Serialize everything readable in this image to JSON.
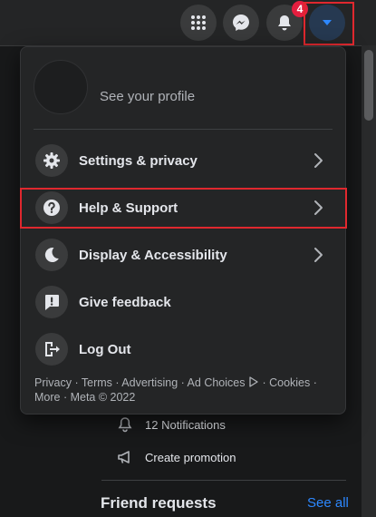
{
  "topbar": {
    "notifications_badge": "4",
    "icons": [
      "menu-grid-icon",
      "messenger-icon",
      "bell-icon",
      "caret-down-icon"
    ]
  },
  "account_menu": {
    "profile_link": "See your profile",
    "items": [
      {
        "label": "Settings & privacy",
        "icon": "gear-icon",
        "has_chevron": true
      },
      {
        "label": "Help & Support",
        "icon": "question-icon",
        "has_chevron": true
      },
      {
        "label": "Display & Accessibility",
        "icon": "moon-icon",
        "has_chevron": true
      },
      {
        "label": "Give feedback",
        "icon": "feedback-icon",
        "has_chevron": false
      },
      {
        "label": "Log Out",
        "icon": "logout-icon",
        "has_chevron": false
      }
    ],
    "footer": {
      "line1": "Privacy · Terms · Advertising · Ad Choices",
      "line1b": "· Cookies ·",
      "line2": "More · Meta © 2022"
    }
  },
  "background": {
    "notifications": "12 Notifications",
    "create_promotion": "Create promotion",
    "friend_requests": "Friend requests",
    "see_all": "See all"
  },
  "colors": {
    "highlight": "#e0282e",
    "link": "#2d88ff",
    "badge": "#e41e3f"
  }
}
